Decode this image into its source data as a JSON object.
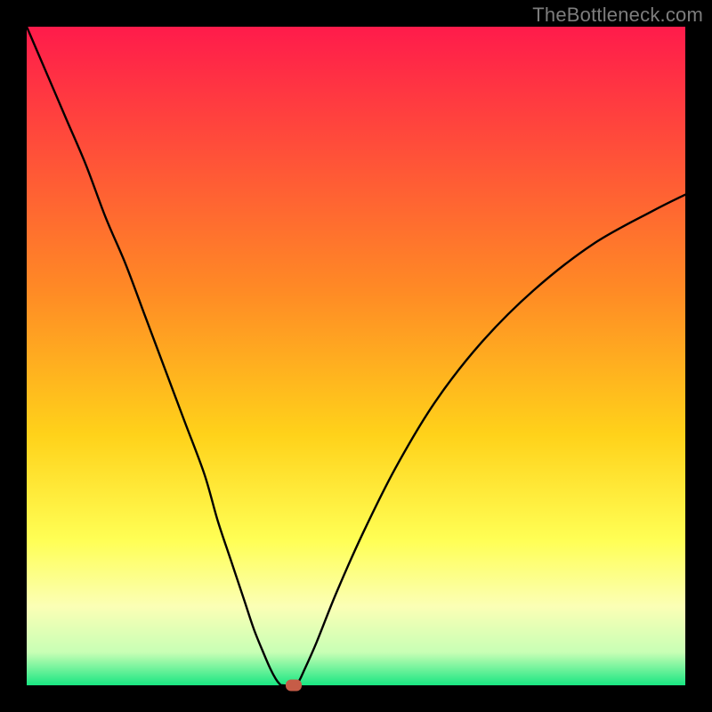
{
  "watermark": "TheBottleneck.com",
  "chart_data": {
    "type": "line",
    "title": "",
    "xlabel": "",
    "ylabel": "",
    "xlim": [
      0,
      100
    ],
    "ylim": [
      0,
      100
    ],
    "gradient_stops": [
      {
        "offset": 0,
        "color": "#ff1b4b"
      },
      {
        "offset": 40,
        "color": "#ff8a25"
      },
      {
        "offset": 62,
        "color": "#ffd21a"
      },
      {
        "offset": 78,
        "color": "#ffff55"
      },
      {
        "offset": 88,
        "color": "#fbffb5"
      },
      {
        "offset": 95,
        "color": "#c8ffb5"
      },
      {
        "offset": 100,
        "color": "#19e682"
      }
    ],
    "series": [
      {
        "name": "bottleneck-curve",
        "x": [
          0,
          3,
          6,
          9,
          12,
          15,
          18,
          21,
          24,
          27,
          29,
          31,
          33,
          34.5,
          36,
          37,
          37.8,
          38.4,
          38.8,
          40.5,
          41.3,
          42,
          44,
          47,
          51,
          56,
          62,
          69,
          77,
          86,
          95,
          100
        ],
        "y": [
          100,
          93,
          86,
          79,
          71,
          64,
          56,
          48,
          40,
          32,
          25,
          19,
          13,
          8.5,
          4.8,
          2.5,
          1.0,
          0.2,
          0,
          0,
          0.6,
          2.0,
          6.5,
          14,
          23,
          33,
          43,
          52,
          60,
          67,
          72,
          74.5
        ]
      }
    ],
    "flat_segment": {
      "x_start": 38.8,
      "x_end": 40.5,
      "y": 0
    },
    "marker": {
      "x": 40.5,
      "y": 0,
      "color": "#c65c47"
    }
  }
}
